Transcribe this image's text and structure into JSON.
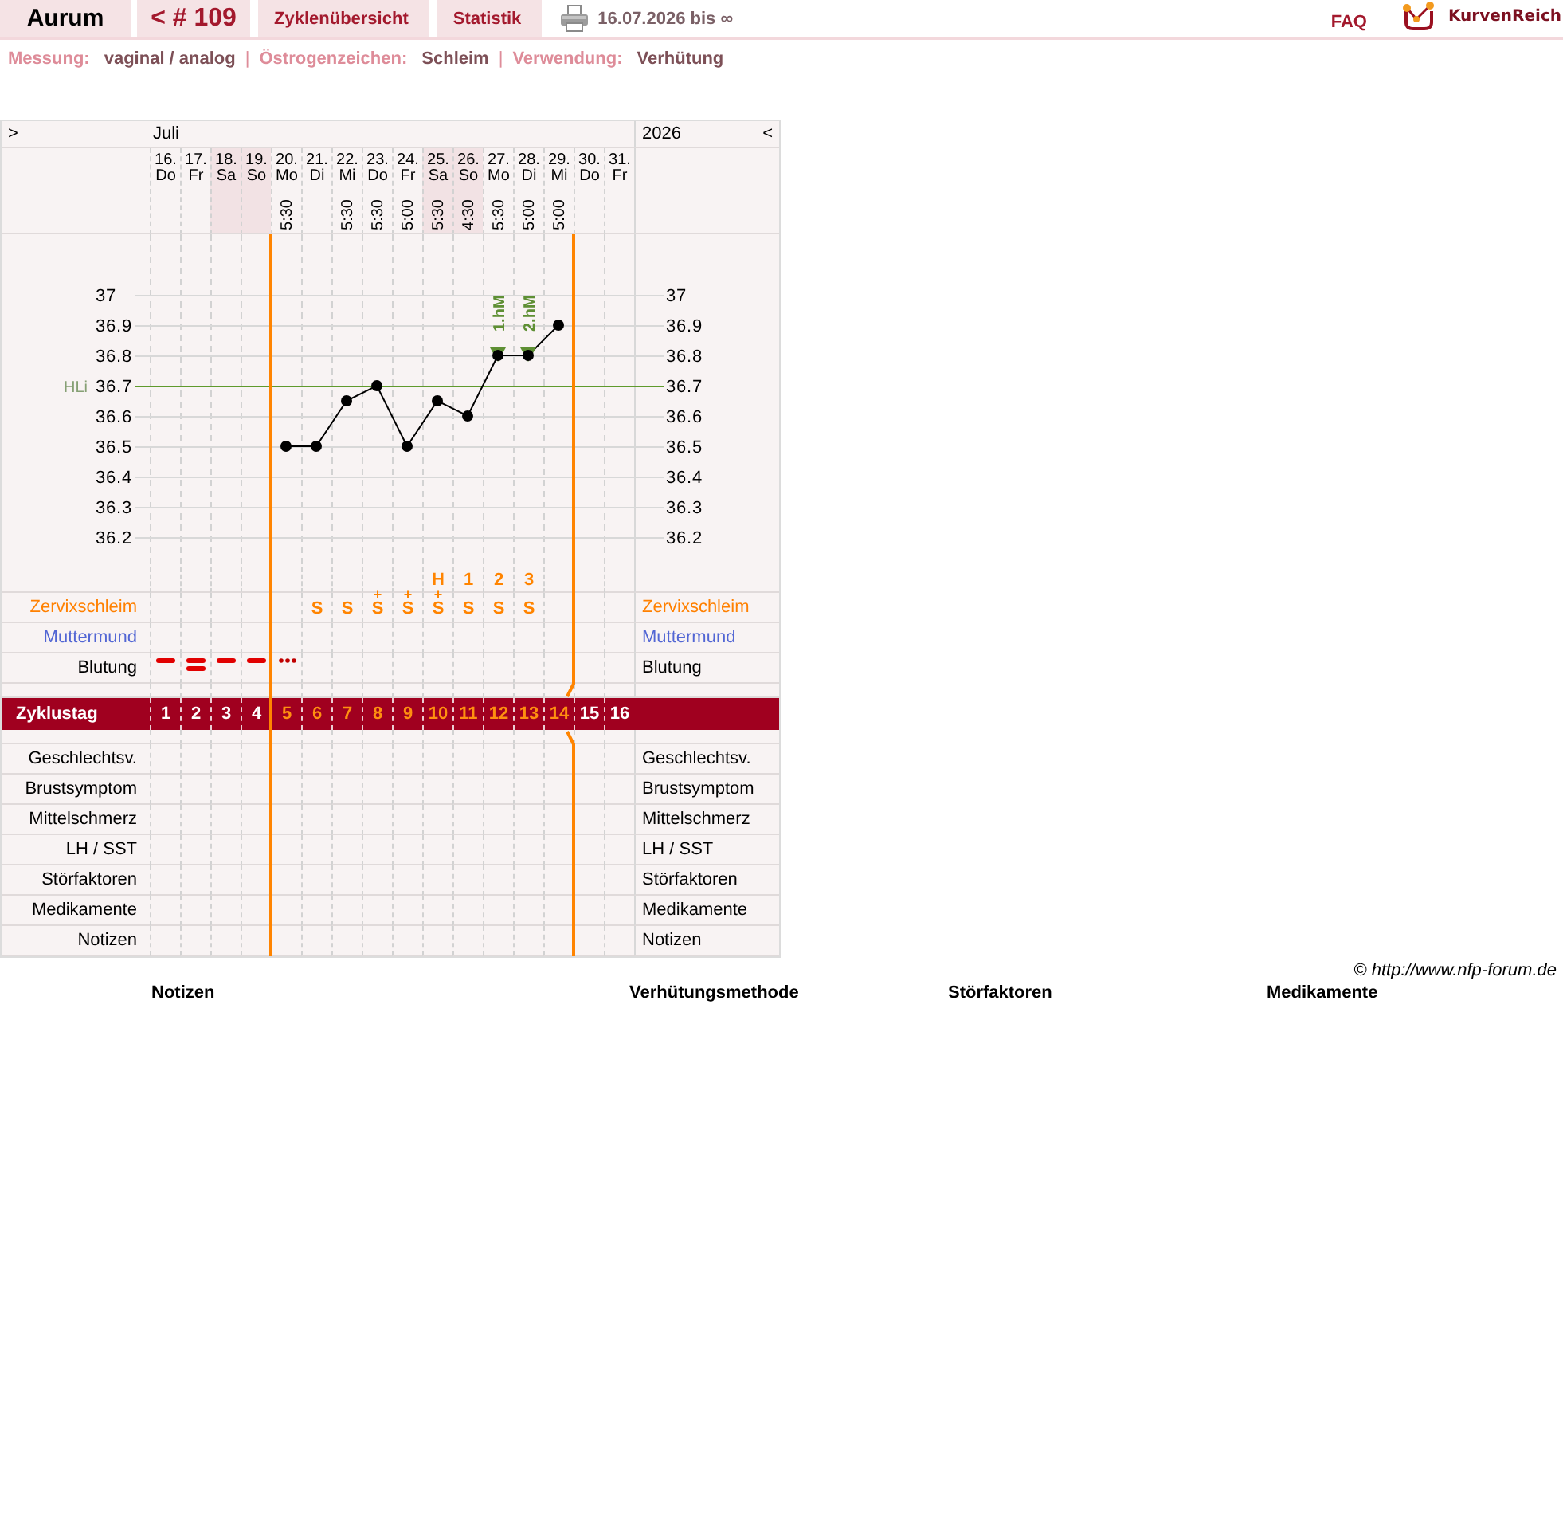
{
  "nav": {
    "user": "Aurum",
    "cycle": "< # 109",
    "tabs": [
      {
        "label": "Zyklenübersicht"
      },
      {
        "label": "Statistik"
      }
    ],
    "date_range": "16.07.2026 bis ∞",
    "faq": "FAQ",
    "brand": "KurvenReich"
  },
  "settings": [
    {
      "label": "Messung:",
      "value": "vaginal / analog"
    },
    {
      "separator": "|",
      "label": "Östrogenzeichen:",
      "value": "Schleim"
    },
    {
      "separator": "|",
      "label": "Verwendung:",
      "value": "Verhütung"
    }
  ],
  "cycle_sheet": {
    "prev": ">",
    "month": "Juli",
    "year": "2026",
    "next": "<",
    "chart_data": {
      "type": "line",
      "categories": [
        "16.",
        "17.",
        "18.",
        "19.",
        "20.",
        "21.",
        "22.",
        "23.",
        "24.",
        "25.",
        "26.",
        "27.",
        "28.",
        "29.",
        "30.",
        "31."
      ],
      "series": [
        {
          "color": "#000000",
          "marker": "circle",
          "values": [
            null,
            null,
            null,
            null,
            36.5,
            36.5,
            36.65,
            36.7,
            36.5,
            36.65,
            36.6,
            36.8,
            36.8,
            36.9,
            null,
            null
          ]
        }
      ],
      "ylim": [
        36.1,
        37.2
      ],
      "yticks": [
        {
          "value": 36.2,
          "label": "36.2"
        },
        {
          "value": 36.3,
          "label": "36.3"
        },
        {
          "value": 36.4,
          "label": "36.4"
        },
        {
          "value": 36.5,
          "label": "36.5"
        },
        {
          "value": 36.6,
          "label": "36.6"
        },
        {
          "value": 36.7,
          "label": "36.7"
        },
        {
          "value": 36.8,
          "label": "36.8"
        },
        {
          "value": 36.9,
          "label": "36.9"
        },
        {
          "value": 37,
          "label": "37"
        }
      ],
      "grid": true,
      "ref_lines": [
        {
          "axis": "y",
          "value": 36.7,
          "color": "#5f9a2c"
        }
      ]
    },
    "threshold_label": "HLi",
    "right_scale": [
      "37",
      "36.9",
      "36.8",
      "36.7",
      "36.6",
      "36.5",
      "36.4",
      "36.3",
      "36.2"
    ],
    "days": [
      {
        "weekday": "Do",
        "weekend": false,
        "bleeding": {
          "kind": "single"
        },
        "cycle_day": "1",
        "highlighted": false
      },
      {
        "weekday": "Fr",
        "weekend": false,
        "bleeding": {
          "kind": "double"
        },
        "cycle_day": "2",
        "highlighted": false
      },
      {
        "weekday": "Sa",
        "weekend": true,
        "bleeding": {
          "kind": "single"
        },
        "cycle_day": "3",
        "highlighted": false
      },
      {
        "weekday": "So",
        "weekend": true,
        "bleeding": {
          "kind": "single"
        },
        "cycle_day": "4",
        "highlighted": false
      },
      {
        "weekday": "Mo",
        "weekend": false,
        "time": "5:30",
        "bleeding": {
          "kind": "dots"
        },
        "cycle_day": "5",
        "highlighted": true
      },
      {
        "weekday": "Di",
        "weekend": false,
        "mucus": "S",
        "cycle_day": "6",
        "highlighted": true
      },
      {
        "weekday": "Mi",
        "weekend": false,
        "time": "5:30",
        "mucus": "S",
        "cycle_day": "7",
        "highlighted": true
      },
      {
        "weekday": "Do",
        "weekend": false,
        "time": "5:30",
        "mucus": "S",
        "mucus_mark": "+",
        "cycle_day": "8",
        "highlighted": true
      },
      {
        "weekday": "Fr",
        "weekend": false,
        "time": "5:00",
        "mucus": "S",
        "mucus_mark": "+",
        "cycle_day": "9",
        "highlighted": true
      },
      {
        "weekday": "Sa",
        "weekend": true,
        "time": "5:30",
        "peak": "H",
        "mucus": "S",
        "mucus_mark": "+",
        "cycle_day": "10",
        "highlighted": true
      },
      {
        "weekday": "So",
        "weekend": true,
        "time": "4:30",
        "peak": "1",
        "mucus": "S",
        "cycle_day": "11",
        "highlighted": true
      },
      {
        "weekday": "Mo",
        "weekend": false,
        "time": "5:30",
        "marker": "1.hM",
        "peak": "2",
        "mucus": "S",
        "cycle_day": "12",
        "highlighted": true
      },
      {
        "weekday": "Di",
        "weekend": false,
        "time": "5:00",
        "marker": "2.hM",
        "peak": "3",
        "mucus": "S",
        "cycle_day": "13",
        "highlighted": true
      },
      {
        "weekday": "Mi",
        "weekend": false,
        "time": "5:00",
        "cycle_day": "14",
        "highlighted": true
      },
      {
        "weekday": "Do",
        "weekend": false,
        "cycle_day": "15",
        "highlighted": false
      },
      {
        "weekday": "Fr",
        "weekend": false,
        "cycle_day": "16",
        "highlighted": false
      }
    ],
    "rows_top": [
      {
        "kind": "mucus",
        "label": "Zervixschleim",
        "label_right": "Zervixschleim",
        "color": "#ff8000"
      },
      {
        "kind": "cervix",
        "label": "Muttermund",
        "label_right": "Muttermund",
        "color": "#5266d4"
      },
      {
        "kind": "bleeding",
        "label": "Blutung",
        "label_right": "Blutung",
        "color": "#000000"
      }
    ],
    "cycle_day_label": "Zyklustag",
    "rows_bottom": [
      {
        "label": "Geschlechtsv.",
        "label_right": "Geschlechtsv."
      },
      {
        "label": "Brustsymptom",
        "label_right": "Brustsymptom"
      },
      {
        "label": "Mittelschmerz",
        "label_right": "Mittelschmerz"
      },
      {
        "label": "LH / SST",
        "label_right": "LH / SST"
      },
      {
        "label": "Störfaktoren",
        "label_right": "Störfaktoren"
      },
      {
        "label": "Medikamente",
        "label_right": "Medikamente"
      },
      {
        "label": "Notizen",
        "label_right": "Notizen"
      }
    ]
  },
  "copyright": "© http://www.nfp-forum.de",
  "note_headings": [
    "Notizen",
    "Verhütungsmethode",
    "Störfaktoren",
    "Medikamente"
  ]
}
